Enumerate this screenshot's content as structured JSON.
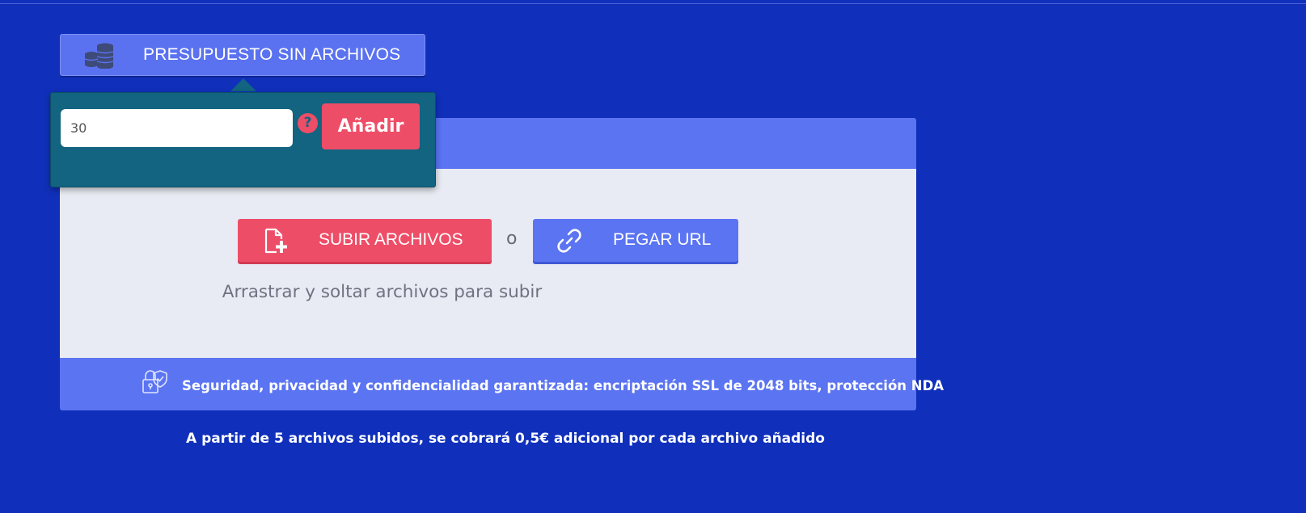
{
  "budget_button": {
    "label": "PRESUPUESTO SIN ARCHIVOS",
    "icon": "coins-icon"
  },
  "popover": {
    "input_value": "30",
    "help_symbol": "?",
    "add_label": "Añadir"
  },
  "upload": {
    "upload_label": "SUBIR ARCHIVOS",
    "upload_icon": "file-plus-icon",
    "or_text": "o",
    "url_label": "PEGAR URL",
    "url_icon": "link-icon",
    "drop_hint": "Arrastrar y soltar archivos para subir"
  },
  "security": {
    "icon": "lock-shield-icon",
    "text": "Seguridad, privacidad y confidencialidad garantizada: encriptación SSL de 2048 bits, protección NDA"
  },
  "notice": "A partir de 5 archivos subidos, se cobrará 0,5€ adicional por cada archivo añadido",
  "colors": {
    "background": "#1030bb",
    "panel_accent": "#5b74f2",
    "upload_button": "#ee4d67",
    "popover": "#126480"
  }
}
